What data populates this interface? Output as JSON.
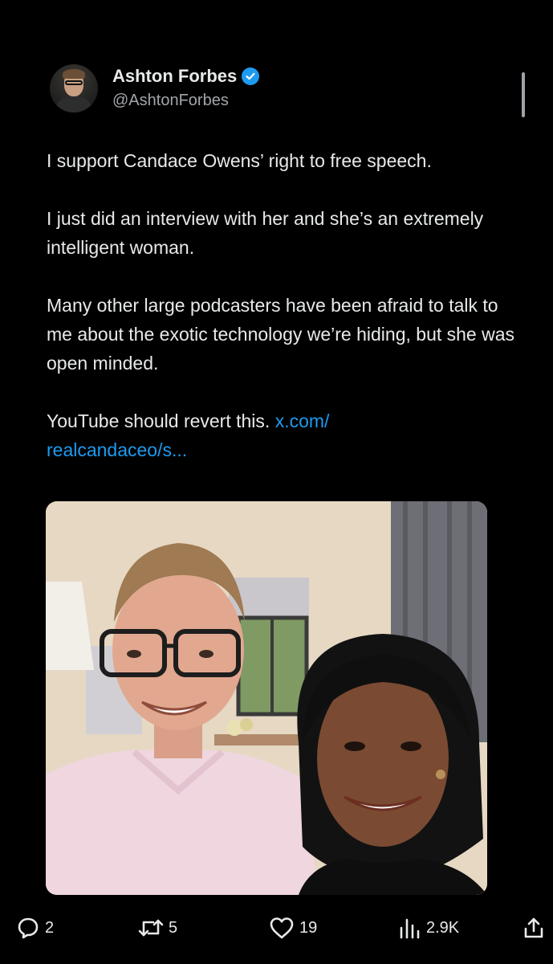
{
  "author": {
    "display_name": "Ashton Forbes",
    "handle": "@AshtonForbes",
    "verified_icon": "verified-badge-icon",
    "avatar_icon": "profile-avatar"
  },
  "tweet": {
    "paragraphs": [
      "I support Candace Owens’ right to free speech.",
      "I just did an interview with her and she’s an extremely intelligent woman.",
      "Many other large podcasters have been afraid to talk to me about the exotic technology we’re hiding, but she was open minded."
    ],
    "last_paragraph_text": "YouTube should revert this.",
    "link_line1": "x.com/",
    "link_line2": "realcandaceo/s..."
  },
  "media": {
    "description_icon": "photo-media"
  },
  "actions": {
    "replies": "2",
    "reposts": "5",
    "likes": "19",
    "views": "2.9K"
  },
  "colors": {
    "background": "#000000",
    "text": "#e7e9ea",
    "secondary_text": "#a1a6ab",
    "link": "#1d9bf0",
    "verified": "#1d9bf0"
  }
}
